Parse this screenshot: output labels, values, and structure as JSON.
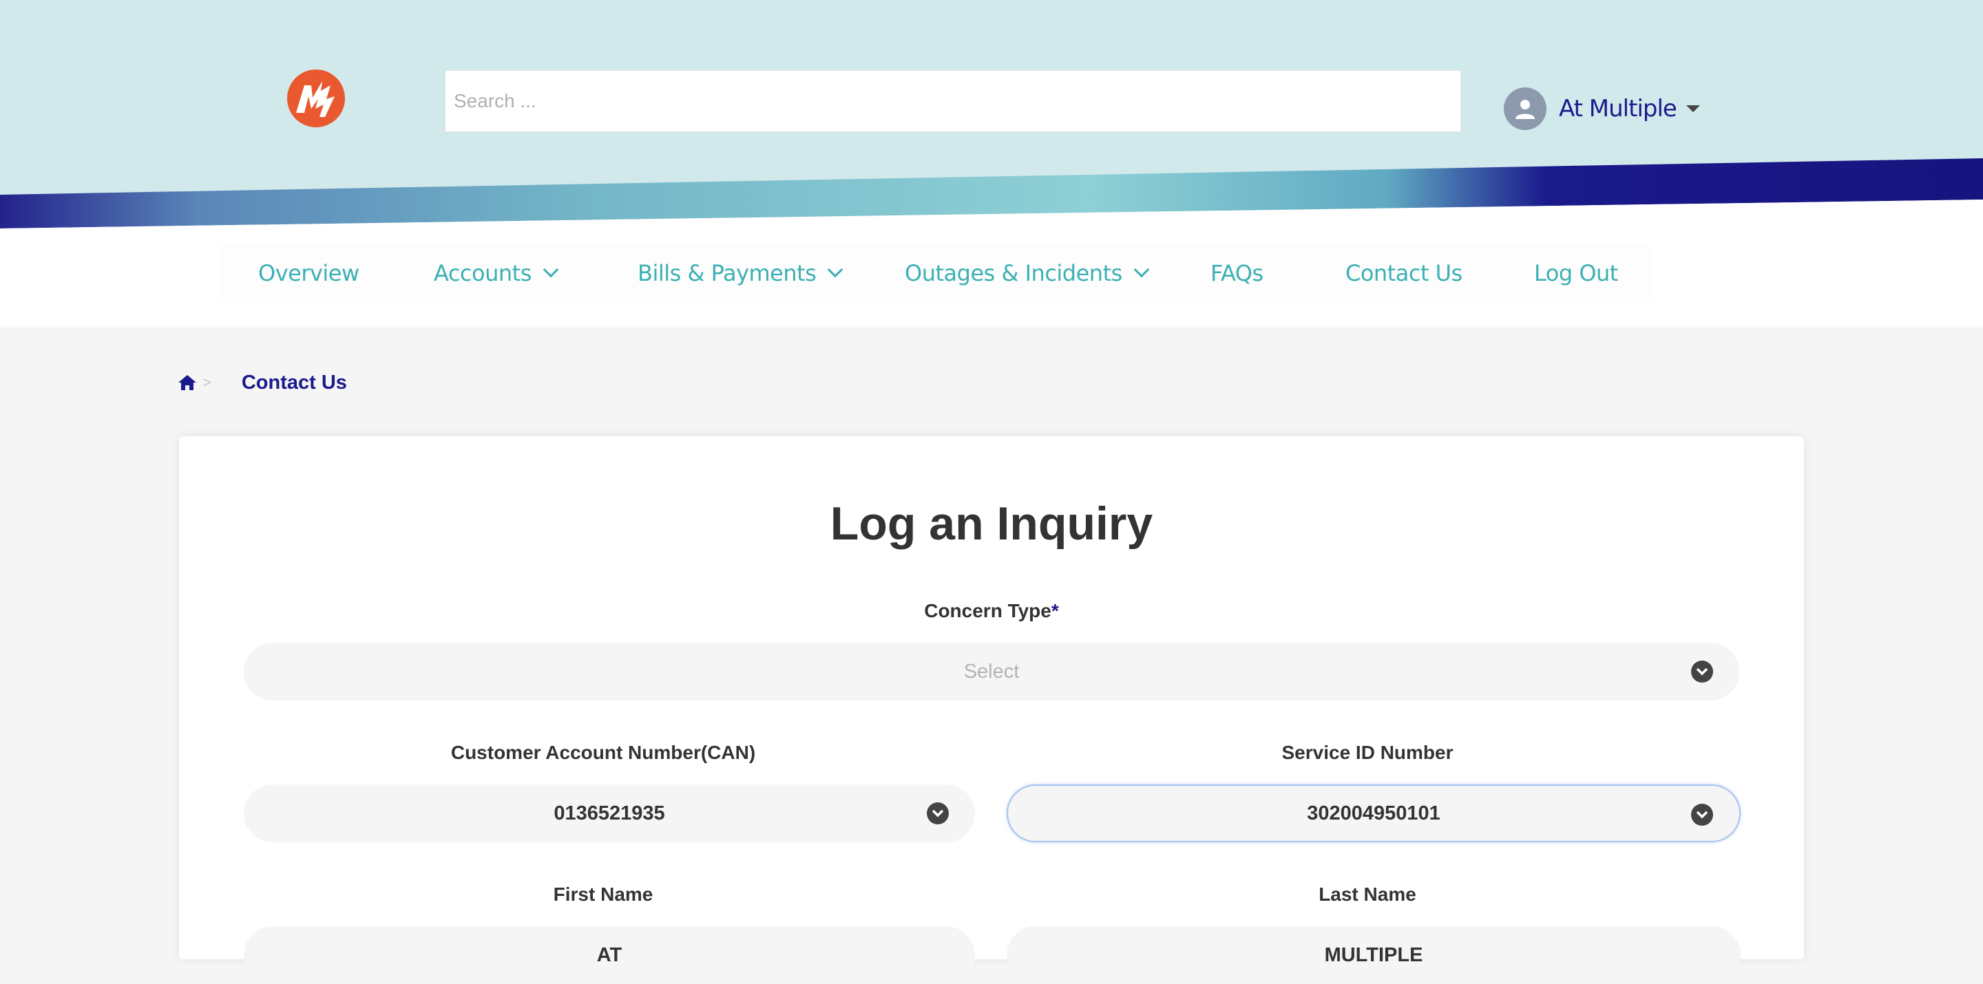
{
  "header": {
    "search_placeholder": "Search ...",
    "user_name": "At Multiple",
    "colors": {
      "background": "#d2e9ec",
      "brand_orange": "#e9582e",
      "brand_navy": "#1b1a8c",
      "teal": "#3bb0b3"
    }
  },
  "nav": {
    "items": [
      {
        "label": "Overview",
        "dropdown": false
      },
      {
        "label": "Accounts",
        "dropdown": true
      },
      {
        "label": "Bills & Payments",
        "dropdown": true
      },
      {
        "label": "Outages & Incidents",
        "dropdown": true
      },
      {
        "label": "FAQs",
        "dropdown": false
      },
      {
        "label": "Contact Us",
        "dropdown": false
      },
      {
        "label": "Log Out",
        "dropdown": false
      }
    ]
  },
  "breadcrumb": {
    "home_icon": "home-icon",
    "separator": ">",
    "current": "Contact Us"
  },
  "form": {
    "title": "Log an Inquiry",
    "concern_type": {
      "label": "Concern Type",
      "required_mark": "*",
      "placeholder": "Select"
    },
    "can": {
      "label": "Customer Account Number(CAN)",
      "value": "0136521935"
    },
    "service_id": {
      "label": "Service ID Number",
      "value": "302004950101"
    },
    "first_name": {
      "label": "First Name",
      "value": "AT"
    },
    "last_name": {
      "label": "Last Name",
      "value": "MULTIPLE"
    }
  }
}
